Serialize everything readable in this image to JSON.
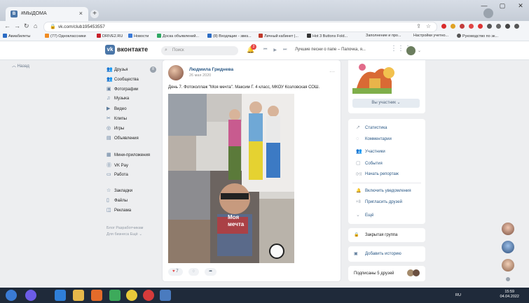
{
  "browser": {
    "tab_title": "#МЫДОМА",
    "new_tab": "+",
    "close": "×",
    "url": "vk.com/club195453557",
    "window_controls": [
      "—",
      "▢",
      "✕"
    ]
  },
  "bookmarks": [
    {
      "label": "Авиабилеты",
      "color": "#2b6cc4"
    },
    {
      "label": "(77) Одноклассники",
      "color": "#f08c22"
    },
    {
      "label": "DRIVE2.RU",
      "color": "#c8202a"
    },
    {
      "label": "Новости",
      "color": "#3b7bd8"
    },
    {
      "label": "Доска объявлений...",
      "color": "#2ea862"
    },
    {
      "label": "(8) Входящие - звез...",
      "color": "#2b6cc4"
    },
    {
      "label": "Личный кабинет |...",
      "color": "#c0392b"
    },
    {
      "label": "Hot 3 Buttons Fold...",
      "color": "#333"
    },
    {
      "label": "Заполнение и про...",
      "color": "#888"
    },
    {
      "label": "Настройки учетно...",
      "color": "#888"
    },
    {
      "label": "Руководство по эк...",
      "color": "#555"
    }
  ],
  "vk": {
    "logo": "вконтакте",
    "search_placeholder": "Поиск",
    "notif_count": "2",
    "now_playing": "Лучшие песни о папе – Папочка, я..."
  },
  "left": {
    "back": "Назад",
    "menu": [
      {
        "label": "Друзья",
        "icon": "friends-icon",
        "glyph": "👥"
      },
      {
        "label": "Сообщества",
        "icon": "groups-icon",
        "glyph": "👥"
      },
      {
        "label": "Фотографии",
        "icon": "photo-icon",
        "glyph": "▣"
      },
      {
        "label": "Музыка",
        "icon": "music-icon",
        "glyph": "♫"
      },
      {
        "label": "Видео",
        "icon": "video-icon",
        "glyph": "▶"
      },
      {
        "label": "Клипы",
        "icon": "clips-icon",
        "glyph": "✂"
      },
      {
        "label": "Игры",
        "icon": "games-icon",
        "glyph": "◎"
      },
      {
        "label": "Объявления",
        "icon": "ads-icon",
        "glyph": "▤"
      },
      {
        "label": "Мини-приложения",
        "icon": "apps-icon",
        "glyph": "▦"
      },
      {
        "label": "VK Pay",
        "icon": "vkpay-icon",
        "glyph": "⓪"
      },
      {
        "label": "Работа",
        "icon": "work-icon",
        "glyph": "▭"
      },
      {
        "label": "Закладки",
        "icon": "bookmarks-icon",
        "glyph": "☆"
      },
      {
        "label": "Файлы",
        "icon": "files-icon",
        "glyph": "▯"
      },
      {
        "label": "Реклама",
        "icon": "advert-icon",
        "glyph": "◫"
      }
    ],
    "friends_badge": "8",
    "footer_line1": "Блог  Разработчикам",
    "footer_line2": "Для бизнеса  Ещё ⌄"
  },
  "post": {
    "author": "Людмила Гриднева",
    "date": "26 мая 2020",
    "text": "День 7. Фотоколлаж \"Моя мечта\". Максим Г. 4 класс, МКОУ Козловская СОШ.",
    "image_text_line1": "Моя",
    "image_text_line2": "мечта",
    "likes": "7",
    "more": "···"
  },
  "right": {
    "join_button": "Вы участник ⌄",
    "actions": [
      {
        "label": "Статистика",
        "icon": "stats-icon",
        "glyph": "↗"
      },
      {
        "label": "Комментарии",
        "icon": "comments-icon",
        "glyph": "◌"
      },
      {
        "label": "Участники",
        "icon": "members-icon",
        "glyph": "👥"
      },
      {
        "label": "События",
        "icon": "events-icon",
        "glyph": "▢"
      },
      {
        "label": "Начать репортаж",
        "icon": "live-icon",
        "glyph": "((•))"
      },
      {
        "label": "Включить уведомления",
        "icon": "bell-icon",
        "glyph": "🔔"
      },
      {
        "label": "Пригласить друзей",
        "icon": "invite-icon",
        "glyph": "+8"
      },
      {
        "label": "Ещё",
        "icon": "more-icon",
        "glyph": "⌄"
      }
    ],
    "closed_group": "Закрытая группа",
    "add_story": "Добавить историю",
    "subscribed": "Подписаны 5 друзей"
  },
  "taskbar": {
    "lang": "RU",
    "time": "15:59",
    "date": "04.04.2022"
  }
}
